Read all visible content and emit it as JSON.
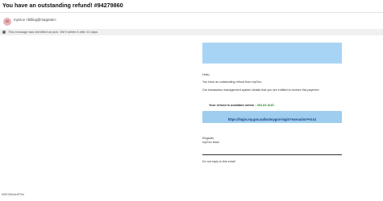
{
  "email": {
    "subject": "You have an outstanding refund! #94279860",
    "avatar_initial": "M",
    "sender": "myGov <billing@magnatv>",
    "recipient": "",
    "junk_notice": "This message was identified as junk. We'll delete it after 10 days."
  },
  "body": {
    "hello": "Hello,",
    "line1": "You have an outstanding refund from myGov.",
    "line2": "Our transaction management system details that you are entitled to receive this payment",
    "refund_label": "Your refund is available online : ",
    "refund_amount": "463.83 AUD",
    "link_text": "https://login.my.gov.au/las/mygov-login?execution=e1s1",
    "regards": "Regards",
    "team": "myGov team",
    "noreply": "Do not reply to this email"
  },
  "footer": {
    "id": "MSE3WeAnRThe"
  },
  "colors": {
    "banner": "#a7d4f5",
    "link_bar": "#9fcdef",
    "amount": "#2e8b2e"
  }
}
